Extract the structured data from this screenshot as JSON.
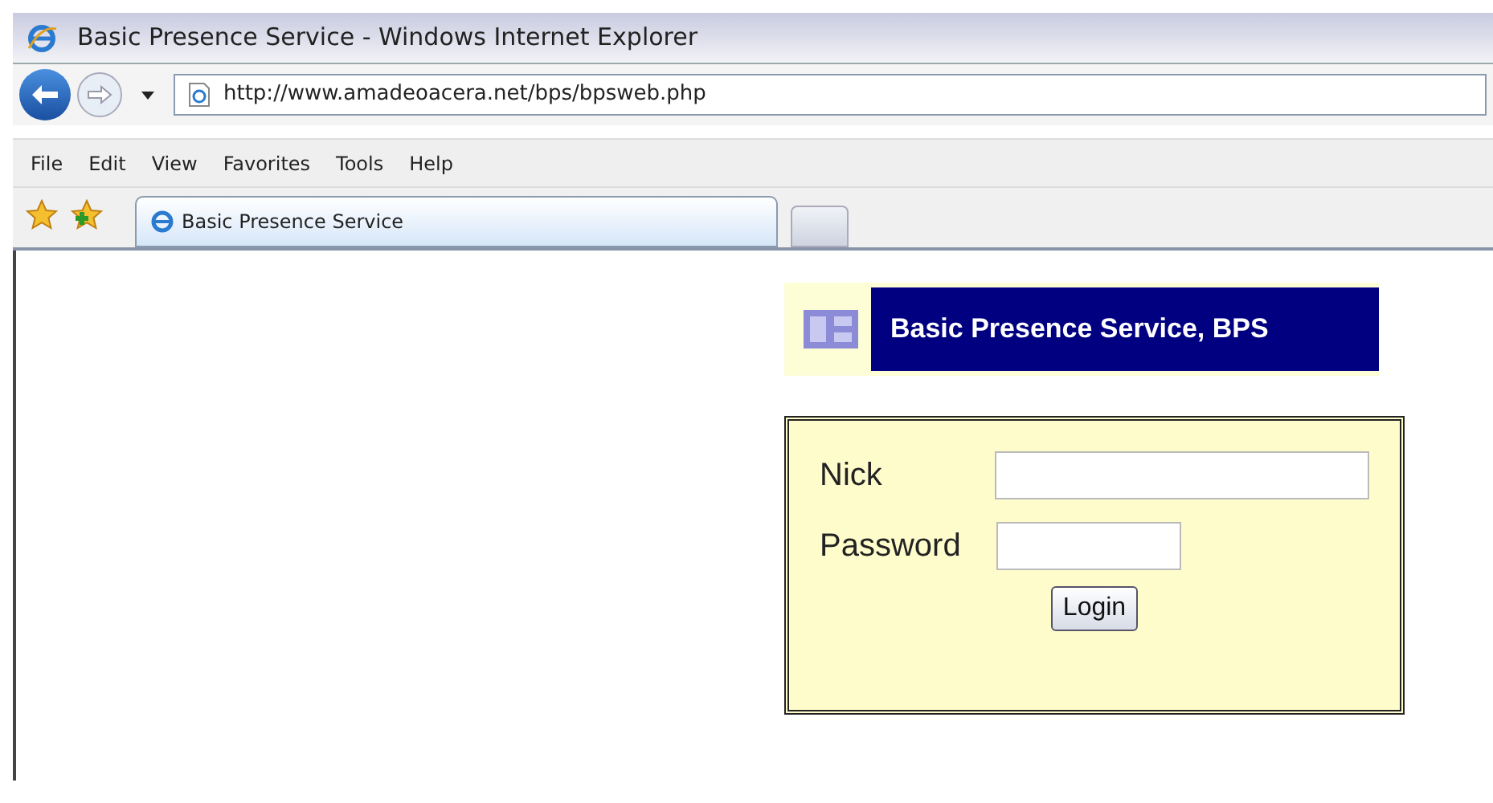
{
  "window": {
    "title": "Basic Presence Service - Windows Internet Explorer"
  },
  "address_bar": {
    "url": "http://www.amadeoacera.net/bps/bpsweb.php"
  },
  "menu": [
    "File",
    "Edit",
    "View",
    "Favorites",
    "Tools",
    "Help"
  ],
  "tabs": [
    {
      "label": "Basic Presence Service",
      "selected": true
    }
  ],
  "page": {
    "banner": "Basic Presence Service, BPS",
    "fields": [
      {
        "label": "Nick",
        "kind": "wide"
      },
      {
        "label": "Password",
        "kind": "short"
      }
    ],
    "button": "Login"
  }
}
